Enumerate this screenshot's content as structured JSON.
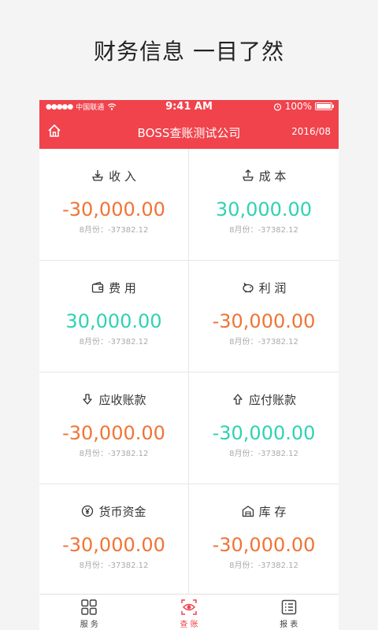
{
  "headline": "财务信息 一目了然",
  "status": {
    "signal_dots": "●●●●●",
    "carrier": "中国联通",
    "time": "9:41 AM",
    "battery": "100%",
    "battery_level": 1.0
  },
  "header": {
    "title": "BOSS查账测试公司",
    "date": "2016/08"
  },
  "cards": [
    {
      "label": "收 入",
      "icon": "income-icon",
      "amount": "-30,000.00",
      "sub": "8月份：-37382.12"
    },
    {
      "label": "成 本",
      "icon": "cost-icon",
      "amount": "30,000.00",
      "sub": "8月份：-37382.12"
    },
    {
      "label": "费 用",
      "icon": "wallet-icon",
      "amount": "30,000.00",
      "sub": "8月份：-37382.12"
    },
    {
      "label": "利 润",
      "icon": "piggy-bank-icon",
      "amount": "-30,000.00",
      "sub": "8月份：-37382.12"
    },
    {
      "label": "应收账款",
      "icon": "receivable-icon",
      "amount": "-30,000.00",
      "sub": "8月份：-37382.12"
    },
    {
      "label": "应付账款",
      "icon": "payable-icon",
      "amount": "-30,000.00",
      "sub": "8月份：-37382.12"
    },
    {
      "label": "货币资金",
      "icon": "yen-coin-icon",
      "amount": "-30,000.00",
      "sub": "8月份：-37382.12"
    },
    {
      "label": "库 存",
      "icon": "warehouse-icon",
      "amount": "-30,000.00",
      "sub": "8月份：-37382.12"
    }
  ],
  "tabs": [
    {
      "label": "服 务",
      "icon": "grid-icon",
      "active": false
    },
    {
      "label": "查 账",
      "icon": "eye-icon",
      "active": true
    },
    {
      "label": "报 表",
      "icon": "list-icon",
      "active": false
    }
  ],
  "colors": {
    "brand": "#f0434c",
    "negative": "#f07436",
    "positive": "#2fd2b3"
  }
}
